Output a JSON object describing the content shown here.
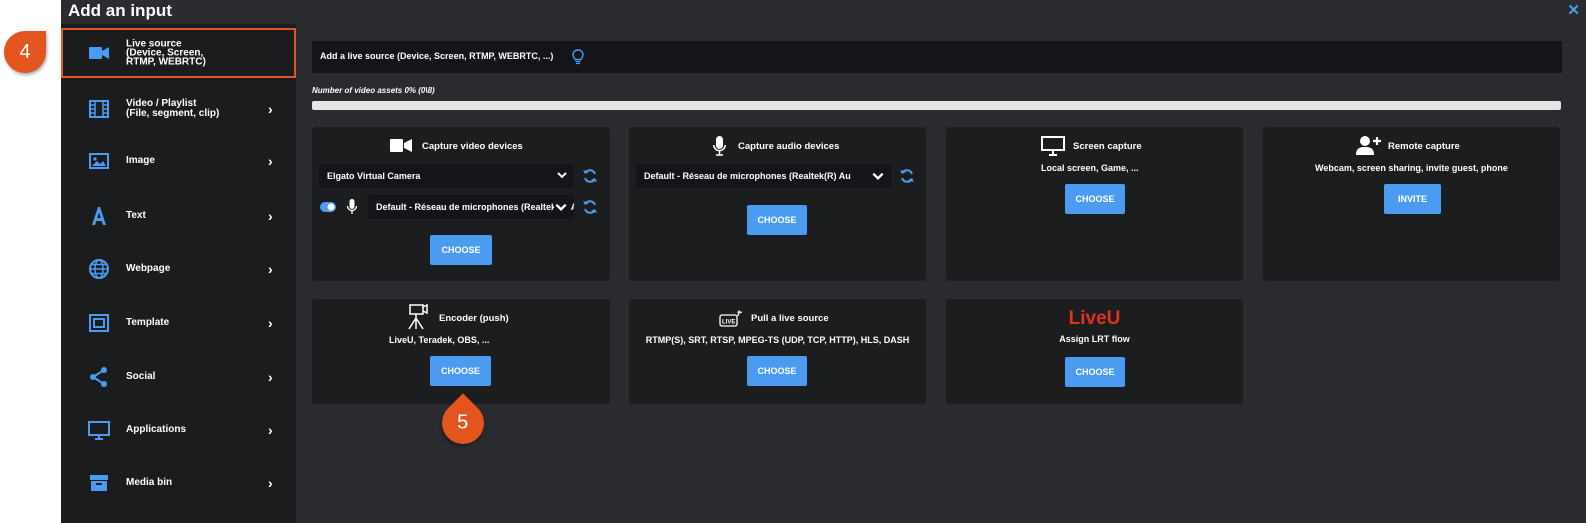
{
  "dialog": {
    "title": "Add an input",
    "close_icon": "close-icon"
  },
  "sidebar": {
    "items": [
      {
        "label": "Live source\n(Device, Screen,\nRTMP, WEBRTC)",
        "icon": "camera-icon"
      },
      {
        "label": "Video / Playlist\n(File, segment, clip)",
        "icon": "film-icon"
      },
      {
        "label": "Image",
        "icon": "image-icon"
      },
      {
        "label": "Text",
        "icon": "text-icon"
      },
      {
        "label": "Webpage",
        "icon": "globe-icon"
      },
      {
        "label": "Template",
        "icon": "template-icon"
      },
      {
        "label": "Social",
        "icon": "share-icon"
      },
      {
        "label": "Applications",
        "icon": "monitor-icon"
      },
      {
        "label": "Media bin",
        "icon": "archive-icon"
      }
    ]
  },
  "main": {
    "header": "Add a live source (Device, Screen, RTMP, WEBRTC, ...)",
    "assets_label": "Number of video assets 0% (0\\8)",
    "assets_progress": 0,
    "cards": {
      "capture_video": {
        "title": "Capture video devices",
        "video_select": "Elgato Virtual Camera",
        "audio_select": "Default - Réseau de microphones (Realtek(R) Au",
        "button": "CHOOSE"
      },
      "capture_audio": {
        "title": "Capture audio devices",
        "audio_select": "Default - Réseau de microphones (Realtek(R) Au",
        "button": "CHOOSE"
      },
      "screen_capture": {
        "title": "Screen capture",
        "subtitle": "Local screen, Game, ...",
        "button": "CHOOSE"
      },
      "remote_capture": {
        "title": "Remote capture",
        "subtitle": "Webcam, screen sharing, invite guest, phone",
        "button": "INVITE"
      },
      "encoder": {
        "title": "Encoder (push)",
        "subtitle": "LiveU, Teradek, OBS, ...",
        "button": "CHOOSE"
      },
      "pull_live": {
        "title": "Pull a live source",
        "subtitle": "RTMP(S), SRT, RTSP, MPEG-TS (UDP, TCP, HTTP), HLS, DASH",
        "button": "CHOOSE"
      },
      "liveu": {
        "logo": "LiveU",
        "subtitle": "Assign LRT flow",
        "button": "CHOOSE"
      }
    }
  },
  "annotations": {
    "step4": "4",
    "step5": "5"
  },
  "colors": {
    "accent": "#4b9cf0",
    "highlight": "#e2551f",
    "sidebar_bg": "#1b1c1e",
    "card_bg": "#1c1d1f",
    "liveu_red": "#e0321c"
  }
}
